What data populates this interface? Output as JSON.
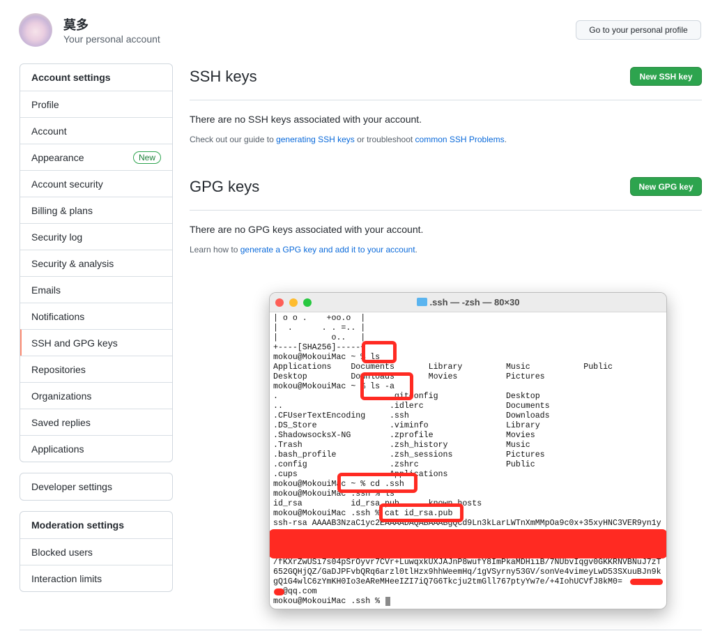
{
  "header": {
    "name": "莫多",
    "subtitle": "Your personal account",
    "profile_button": "Go to your personal profile"
  },
  "sidebar": {
    "account_settings": {
      "title": "Account settings",
      "items": [
        {
          "label": "Profile"
        },
        {
          "label": "Account"
        },
        {
          "label": "Appearance",
          "badge": "New"
        },
        {
          "label": "Account security"
        },
        {
          "label": "Billing & plans"
        },
        {
          "label": "Security log"
        },
        {
          "label": "Security & analysis"
        },
        {
          "label": "Emails"
        },
        {
          "label": "Notifications"
        },
        {
          "label": "SSH and GPG keys",
          "selected": true
        },
        {
          "label": "Repositories"
        },
        {
          "label": "Organizations"
        },
        {
          "label": "Saved replies"
        },
        {
          "label": "Applications"
        }
      ]
    },
    "developer": {
      "title": "Developer settings"
    },
    "moderation": {
      "title": "Moderation settings",
      "items": [
        {
          "label": "Blocked users"
        },
        {
          "label": "Interaction limits"
        }
      ]
    }
  },
  "ssh": {
    "title": "SSH keys",
    "button": "New SSH key",
    "empty": "There are no SSH keys associated with your account.",
    "help_pre": "Check out our guide to ",
    "help_link1": "generating SSH keys",
    "help_mid": " or troubleshoot ",
    "help_link2": "common SSH Problems",
    "help_post": "."
  },
  "gpg": {
    "title": "GPG keys",
    "button": "New GPG key",
    "empty": "There are no GPG keys associated with your account.",
    "help_pre": "Learn how to ",
    "help_link": "generate a GPG key and add it to your account",
    "help_post": "."
  },
  "terminal": {
    "title": ".ssh — -zsh — 80×30",
    "lines": [
      "| o o .    +oo.o  |",
      "|  .      . . =.. |",
      "|           o..   |",
      "+----[SHA256]-----+",
      "mokou@MokouiMac ~ % ls",
      "Applications    Documents       Library         Music           Public",
      "Desktop         Downloads       Movies          Pictures",
      "mokou@MokouiMac ~ % ls -a",
      ".                       .gitconfig              Desktop",
      "..                      .idlerc                 Documents",
      ".CFUserTextEncoding     .ssh                    Downloads",
      ".DS_Store               .viminfo                Library",
      ".ShadowsocksX-NG        .zprofile               Movies",
      ".Trash                  .zsh_history            Music",
      ".bash_profile           .zsh_sessions           Pictures",
      ".config                 .zshrc                  Public",
      ".cups                   Applications",
      "mokou@MokouiMac ~ % cd .ssh",
      "mokou@MokouiMac .ssh % ls",
      "id_rsa          id_rsa.pub      known_hosts",
      "mokou@MokouiMac .ssh % cat id_rsa.pub",
      "ssh-rsa AAAAB3NzaC1yc2EAAAADAQABAAABgQCd9Ln3kLarLWTnXmMMpOa9c0x+35xyHNC3VER9yn1y",
      "",
      "",
      "",
      "/fKXrZwUSi7s04pSrOyvr7CVr+LuwqxkUXJAJnP8wufY8ImPkaMDHiiB/7NUbvIqgv0GKKRNVBNuJ7zT",
      "652GQHjQZ/GaDJPFvbQRq6arzl0tlHzx9hhWeemHq/1gVSyrny53GV/sonVe4vimeyLwD53SXuuBJn9k",
      "gQ1G4wlC6zYmKH0Io3eAReMHeeIZI7iQ7G6Tkcju2tmGll767ptyYw7e/+4IohUCVfJ8kM0=",
      "  @qq.com",
      "mokou@MokouiMac .ssh % "
    ]
  },
  "colors": {
    "primary_button": "#2da44e",
    "link": "#0969da",
    "selected_marker": "#fd8c73",
    "annotation": "#ff2a22"
  }
}
